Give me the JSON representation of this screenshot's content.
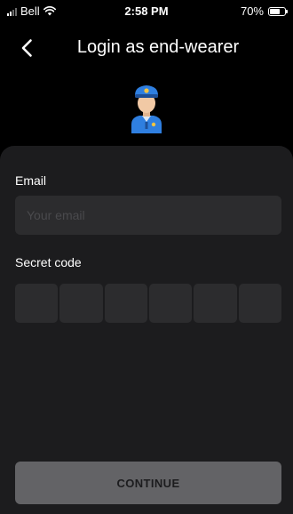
{
  "status_bar": {
    "carrier": "Bell",
    "time": "2:58 PM",
    "battery": "70%",
    "battery_level": 0.7
  },
  "header": {
    "back_icon": "chevron-left-icon",
    "title": "Login as end-wearer"
  },
  "avatar": {
    "icon": "police-officer-icon",
    "colors": {
      "cap": "#2f7fe0",
      "face": "#f1c9a5",
      "uniform": "#2f7fe0",
      "badge": "#f5c542"
    }
  },
  "form": {
    "email_label": "Email",
    "email_placeholder": "Your email",
    "email_value": "",
    "secret_label": "Secret code",
    "code_digits": [
      "",
      "",
      "",
      "",
      "",
      ""
    ]
  },
  "continue_label": "CONTINUE",
  "colors": {
    "background": "#000000",
    "card": "#1c1c1e",
    "field": "#2c2c2e",
    "button": "#636366"
  }
}
